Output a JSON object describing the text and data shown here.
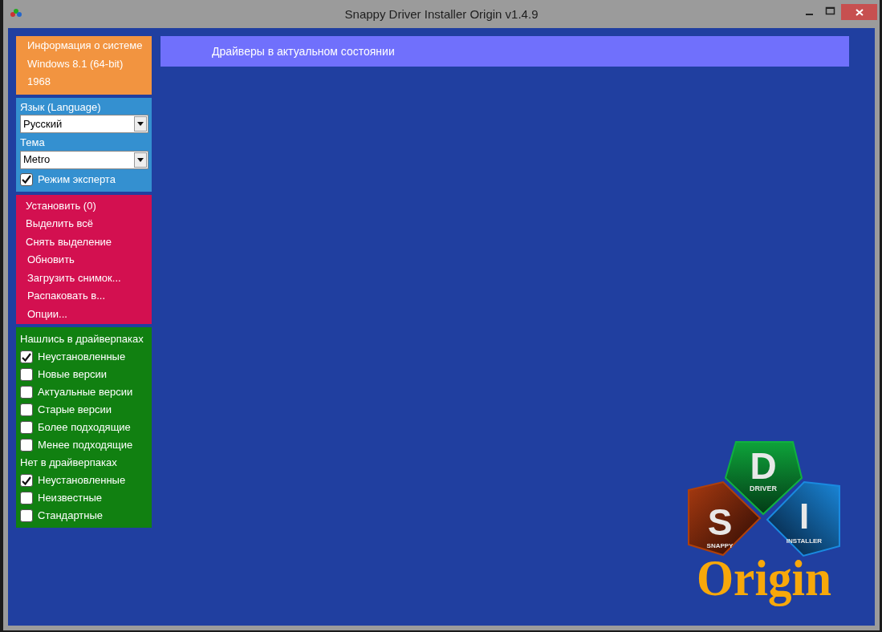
{
  "window": {
    "title": "Snappy Driver Installer Origin v1.4.9"
  },
  "system_info": [
    "Информация о системе",
    "Windows 8.1 (64-bit)",
    "1968"
  ],
  "settings": {
    "language_label": "Язык (Language)",
    "language": "Русский",
    "theme_label": "Тема",
    "theme": "Metro",
    "expert_mode": {
      "label": "Режим эксперта",
      "checked": true
    }
  },
  "actions": [
    "Установить (0)",
    "Выделить всё",
    "Снять выделение",
    "Обновить",
    "Загрузить снимок...",
    "Распаковать в...",
    "Опции..."
  ],
  "filters": [
    {
      "kind": "header",
      "label": "Нашлись в драйверпаках"
    },
    {
      "kind": "checkbox",
      "label": "Неустановленные",
      "checked": true
    },
    {
      "kind": "checkbox",
      "label": "Новые версии",
      "checked": false
    },
    {
      "kind": "checkbox",
      "label": "Актуальные версии",
      "checked": false
    },
    {
      "kind": "checkbox",
      "label": "Старые версии",
      "checked": false
    },
    {
      "kind": "checkbox",
      "label": "Более подходящие",
      "checked": false
    },
    {
      "kind": "checkbox",
      "label": "Менее подходящие",
      "checked": false
    },
    {
      "kind": "header",
      "label": "Нет в драйверпаках"
    },
    {
      "kind": "checkbox",
      "label": "Неустановленные",
      "checked": true
    },
    {
      "kind": "checkbox",
      "label": "Неизвестные",
      "checked": false
    },
    {
      "kind": "checkbox",
      "label": "Стандартные",
      "checked": false
    }
  ],
  "status_message": "Драйверы в актуальном состоянии",
  "logo": {
    "s": "S",
    "snappy": "SNAPPY",
    "d": "D",
    "driver": "DRIVER",
    "i": "I",
    "installer": "INSTALLER",
    "origin": "Origin"
  }
}
